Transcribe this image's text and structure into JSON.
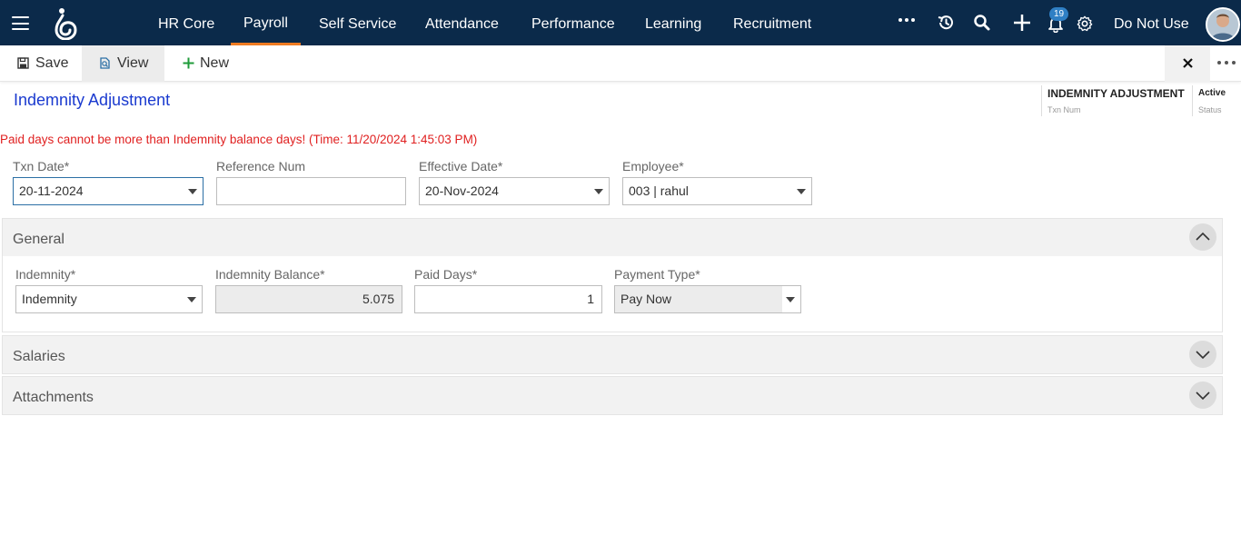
{
  "nav": {
    "items": [
      {
        "label": "HR Core"
      },
      {
        "label": "Payroll"
      },
      {
        "label": "Self Service"
      },
      {
        "label": "Attendance"
      },
      {
        "label": "Performance"
      },
      {
        "label": "Learning"
      },
      {
        "label": "Recruitment"
      }
    ],
    "active": "Payroll",
    "notification_count": "19",
    "user_name": "Do Not Use",
    "icons": [
      "menu-icon",
      "more-icon",
      "history-icon",
      "search-icon",
      "add-icon",
      "bell-icon",
      "gear-icon"
    ]
  },
  "toolbar": {
    "save_label": "Save",
    "view_label": "View",
    "new_label": "New"
  },
  "page": {
    "title": "Indemnity Adjustment",
    "txn_num_value": "INDEMNITY ADJUSTMENT",
    "txn_num_label": "Txn Num",
    "status_value": "Active",
    "status_label": "Status",
    "error_message": "Paid days cannot be more than Indemnity balance days! (Time: 11/20/2024 1:45:03 PM)"
  },
  "header_fields": {
    "txn_date": {
      "label": "Txn Date*",
      "value": "20-11-2024"
    },
    "reference_num": {
      "label": "Reference Num",
      "value": ""
    },
    "effective_date": {
      "label": "Effective Date*",
      "value": "20-Nov-2024"
    },
    "employee": {
      "label": "Employee*",
      "value": "003 | rahul"
    }
  },
  "sections": {
    "general": {
      "title": "General",
      "expanded": true
    },
    "salaries": {
      "title": "Salaries",
      "expanded": false
    },
    "attachments": {
      "title": "Attachments",
      "expanded": false
    }
  },
  "general_fields": {
    "indemnity": {
      "label": "Indemnity*",
      "value": "Indemnity"
    },
    "indemnity_balance": {
      "label": "Indemnity Balance*",
      "value": "5.075"
    },
    "paid_days": {
      "label": "Paid Days*",
      "value": "1"
    },
    "payment_type": {
      "label": "Payment Type*",
      "value": "Pay Now"
    }
  },
  "colors": {
    "nav_bg": "#0b2a4a",
    "active_tab_underline": "#f07c22",
    "title_blue": "#1a3acf",
    "error_red": "#e02020",
    "badge_blue": "#2f7fc4"
  }
}
